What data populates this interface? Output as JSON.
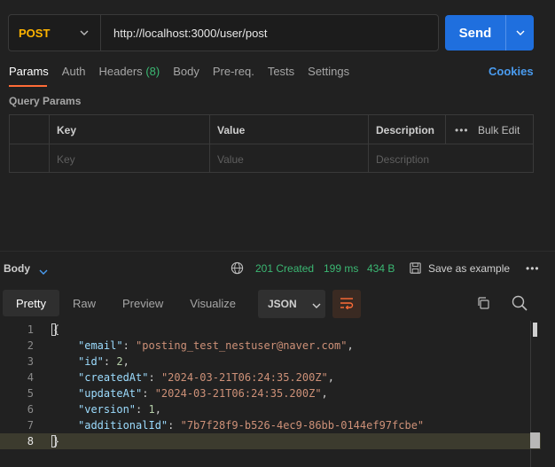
{
  "request": {
    "method": "POST",
    "url": "http://localhost:3000/user/post",
    "send_label": "Send"
  },
  "tabs": [
    {
      "label": "Params",
      "active": true
    },
    {
      "label": "Auth"
    },
    {
      "label": "Headers",
      "count": "(8)"
    },
    {
      "label": "Body"
    },
    {
      "label": "Pre-req."
    },
    {
      "label": "Tests"
    },
    {
      "label": "Settings"
    }
  ],
  "cookies_label": "Cookies",
  "query_params": {
    "title": "Query Params",
    "headers": {
      "key": "Key",
      "value": "Value",
      "description": "Description",
      "bulk_edit": "Bulk Edit",
      "more": "•••"
    },
    "placeholders": {
      "key": "Key",
      "value": "Value",
      "description": "Description"
    }
  },
  "response": {
    "body_label": "Body",
    "status": "201 Created",
    "time": "199 ms",
    "size": "434 B",
    "save_label": "Save as example",
    "more": "•••",
    "view_tabs": [
      "Pretty",
      "Raw",
      "Preview",
      "Visualize"
    ],
    "active_view": "Pretty",
    "format": "JSON",
    "body_json": {
      "email": "posting_test_nestuser@naver.com",
      "id": 2,
      "createdAt": "2024-03-21T06:24:35.200Z",
      "updateAt": "2024-03-21T06:24:35.200Z",
      "version": 1,
      "additionalId": "7b7f28f9-b526-4ec9-86bb-0144ef97fcbe"
    },
    "line_numbers": [
      "1",
      "2",
      "3",
      "4",
      "5",
      "6",
      "7",
      "8"
    ]
  },
  "colors": {
    "method": "#ffb400",
    "send": "#1f6fde",
    "status": "#3bb873",
    "accent": "#ff6c37",
    "link": "#4a9cf0"
  },
  "icons": [
    "chevron-down-icon",
    "globe-icon",
    "save-icon",
    "wrap-lines-icon",
    "copy-icon",
    "search-icon"
  ]
}
